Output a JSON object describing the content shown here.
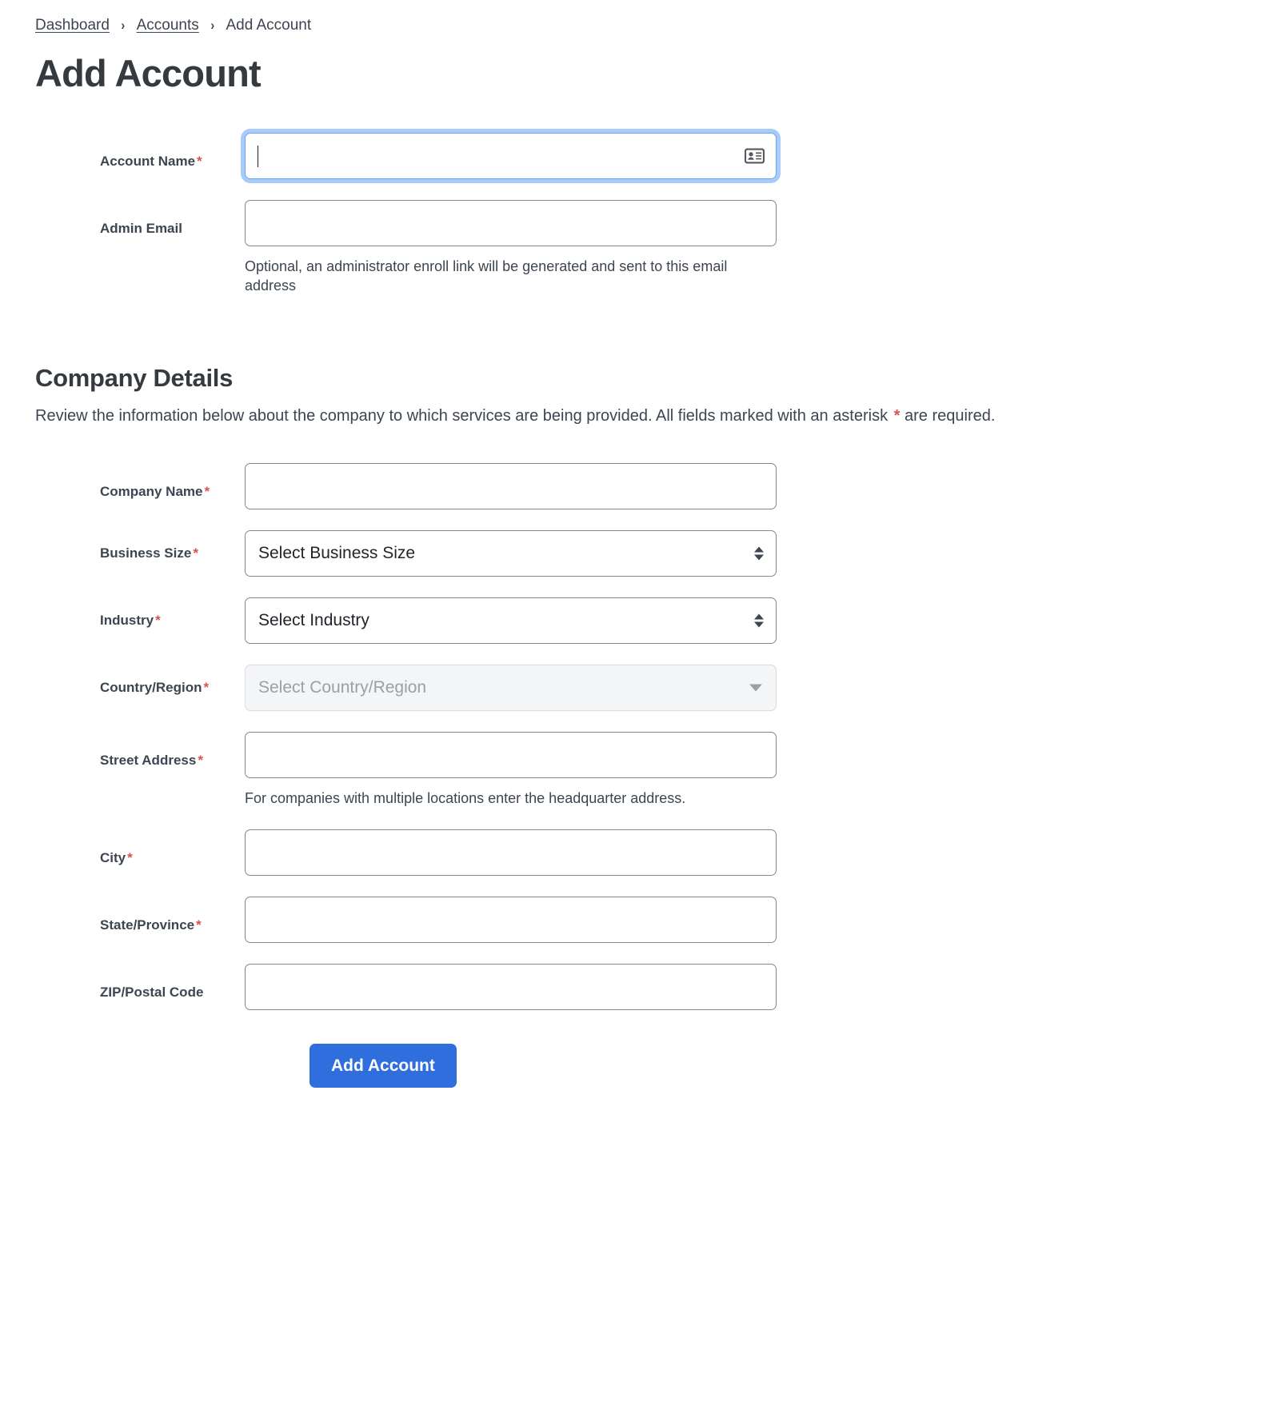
{
  "breadcrumb": {
    "items": [
      {
        "label": "Dashboard",
        "is_link": true
      },
      {
        "label": "Accounts",
        "is_link": true
      },
      {
        "label": "Add Account",
        "is_link": false
      }
    ],
    "separator": "›"
  },
  "page": {
    "title": "Add Account"
  },
  "account_section": {
    "account_name": {
      "label": "Account Name",
      "required_marker": "*",
      "value": "",
      "placeholder": "",
      "icon": "contact-card-icon",
      "focused": true
    },
    "admin_email": {
      "label": "Admin Email",
      "value": "",
      "placeholder": "",
      "help": "Optional, an administrator enroll link will be generated and sent to this email address"
    }
  },
  "company_section": {
    "title": "Company Details",
    "description_before_asterisk": "Review the information below about the company to which services are being provided. All fields marked with an asterisk ",
    "description_asterisk": "*",
    "description_after_asterisk": " are required.",
    "company_name": {
      "label": "Company Name",
      "required_marker": "*",
      "value": "",
      "placeholder": ""
    },
    "business_size": {
      "label": "Business Size",
      "required_marker": "*",
      "selected": "Select Business Size"
    },
    "industry": {
      "label": "Industry",
      "required_marker": "*",
      "selected": "Select Industry"
    },
    "country_region": {
      "label": "Country/Region",
      "required_marker": "*",
      "selected": "Select Country/Region",
      "disabled": true
    },
    "street_address": {
      "label": "Street Address",
      "required_marker": "*",
      "value": "",
      "placeholder": "",
      "help": "For companies with multiple locations enter the headquarter address."
    },
    "city": {
      "label": "City",
      "required_marker": "*",
      "value": "",
      "placeholder": ""
    },
    "state_province": {
      "label": "State/Province",
      "required_marker": "*",
      "value": "",
      "placeholder": ""
    },
    "zip_postal_code": {
      "label": "ZIP/Postal Code",
      "value": "",
      "placeholder": ""
    }
  },
  "submit": {
    "label": "Add Account"
  },
  "colors": {
    "primary_button": "#2f6fdd",
    "focus_ring": "#a8cbfa",
    "required_asterisk": "#d9534f",
    "text": "#3c4551",
    "input_border": "#86878a",
    "disabled_bg": "#f4f5f6"
  }
}
